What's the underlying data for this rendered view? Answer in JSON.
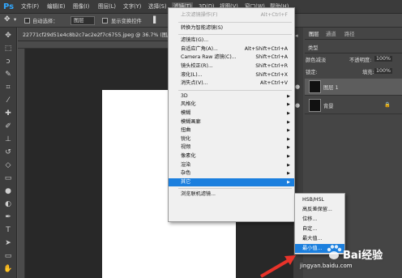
{
  "app": {
    "logo": "Ps"
  },
  "menubar": {
    "items": [
      "文件(F)",
      "编辑(E)",
      "图像(I)",
      "图层(L)",
      "文字(Y)",
      "选择(S)",
      "滤镜(T)",
      "3D(D)",
      "视图(V)",
      "窗口(W)",
      "帮助(H)"
    ],
    "active": "滤镜(T)"
  },
  "options": {
    "auto_select_label": "自动选择：",
    "auto_select_value": "图层",
    "show_transform_label": "显示变换控件"
  },
  "document": {
    "tab_title": "22771cf29d51e4c8b2c7ac2e2f7c6755.jpeg @ 36.7% (图层 1, ..."
  },
  "filter_menu": {
    "items": [
      {
        "label": "上次滤镜操作(F)",
        "shortcut": "Alt+Ctrl+F",
        "disabled": true
      },
      {
        "sep": true
      },
      {
        "label": "转换为智能滤镜(S)"
      },
      {
        "sep": true
      },
      {
        "label": "滤镜库(G)..."
      },
      {
        "label": "自适应广角(A)...",
        "shortcut": "Alt+Shift+Ctrl+A"
      },
      {
        "label": "Camera Raw 滤镜(C)...",
        "shortcut": "Shift+Ctrl+A"
      },
      {
        "label": "镜头校正(R)...",
        "shortcut": "Shift+Ctrl+R"
      },
      {
        "label": "液化(L)...",
        "shortcut": "Shift+Ctrl+X"
      },
      {
        "label": "消失点(V)...",
        "shortcut": "Alt+Ctrl+V"
      },
      {
        "sep": true
      },
      {
        "label": "3D",
        "submenu": true
      },
      {
        "label": "风格化",
        "submenu": true
      },
      {
        "label": "模糊",
        "submenu": true
      },
      {
        "label": "模糊画廊",
        "submenu": true
      },
      {
        "label": "扭曲",
        "submenu": true
      },
      {
        "label": "锐化",
        "submenu": true
      },
      {
        "label": "视频",
        "submenu": true
      },
      {
        "label": "像素化",
        "submenu": true
      },
      {
        "label": "渲染",
        "submenu": true
      },
      {
        "label": "杂色",
        "submenu": true
      },
      {
        "label": "其它",
        "submenu": true,
        "highlighted": true
      },
      {
        "sep": true
      },
      {
        "label": "浏览联机滤镜..."
      }
    ]
  },
  "other_submenu": {
    "items": [
      {
        "label": "HSB/HSL"
      },
      {
        "label": "高反差保留..."
      },
      {
        "label": "位移..."
      },
      {
        "label": "自定..."
      },
      {
        "label": "最大值..."
      },
      {
        "label": "最小值...",
        "highlighted": true
      }
    ]
  },
  "panels": {
    "tabs": [
      "图层",
      "通道",
      "路径"
    ],
    "blend_mode": "颜色减淡",
    "opacity_label": "不透明度:",
    "opacity_value": "100%",
    "lock_label": "锁定:",
    "fill_label": "填充:",
    "fill_value": "100%",
    "kind_label": "类型",
    "layers": [
      {
        "name": "图层 1",
        "selected": true
      },
      {
        "name": "背景",
        "selected": false
      }
    ]
  },
  "watermark": {
    "brand": "Bai经验",
    "url": "jingyan.baidu.com"
  },
  "colors": {
    "highlight": "#1b7fde",
    "arrow": "#e8332a",
    "ps_blue": "#31a8ff"
  }
}
